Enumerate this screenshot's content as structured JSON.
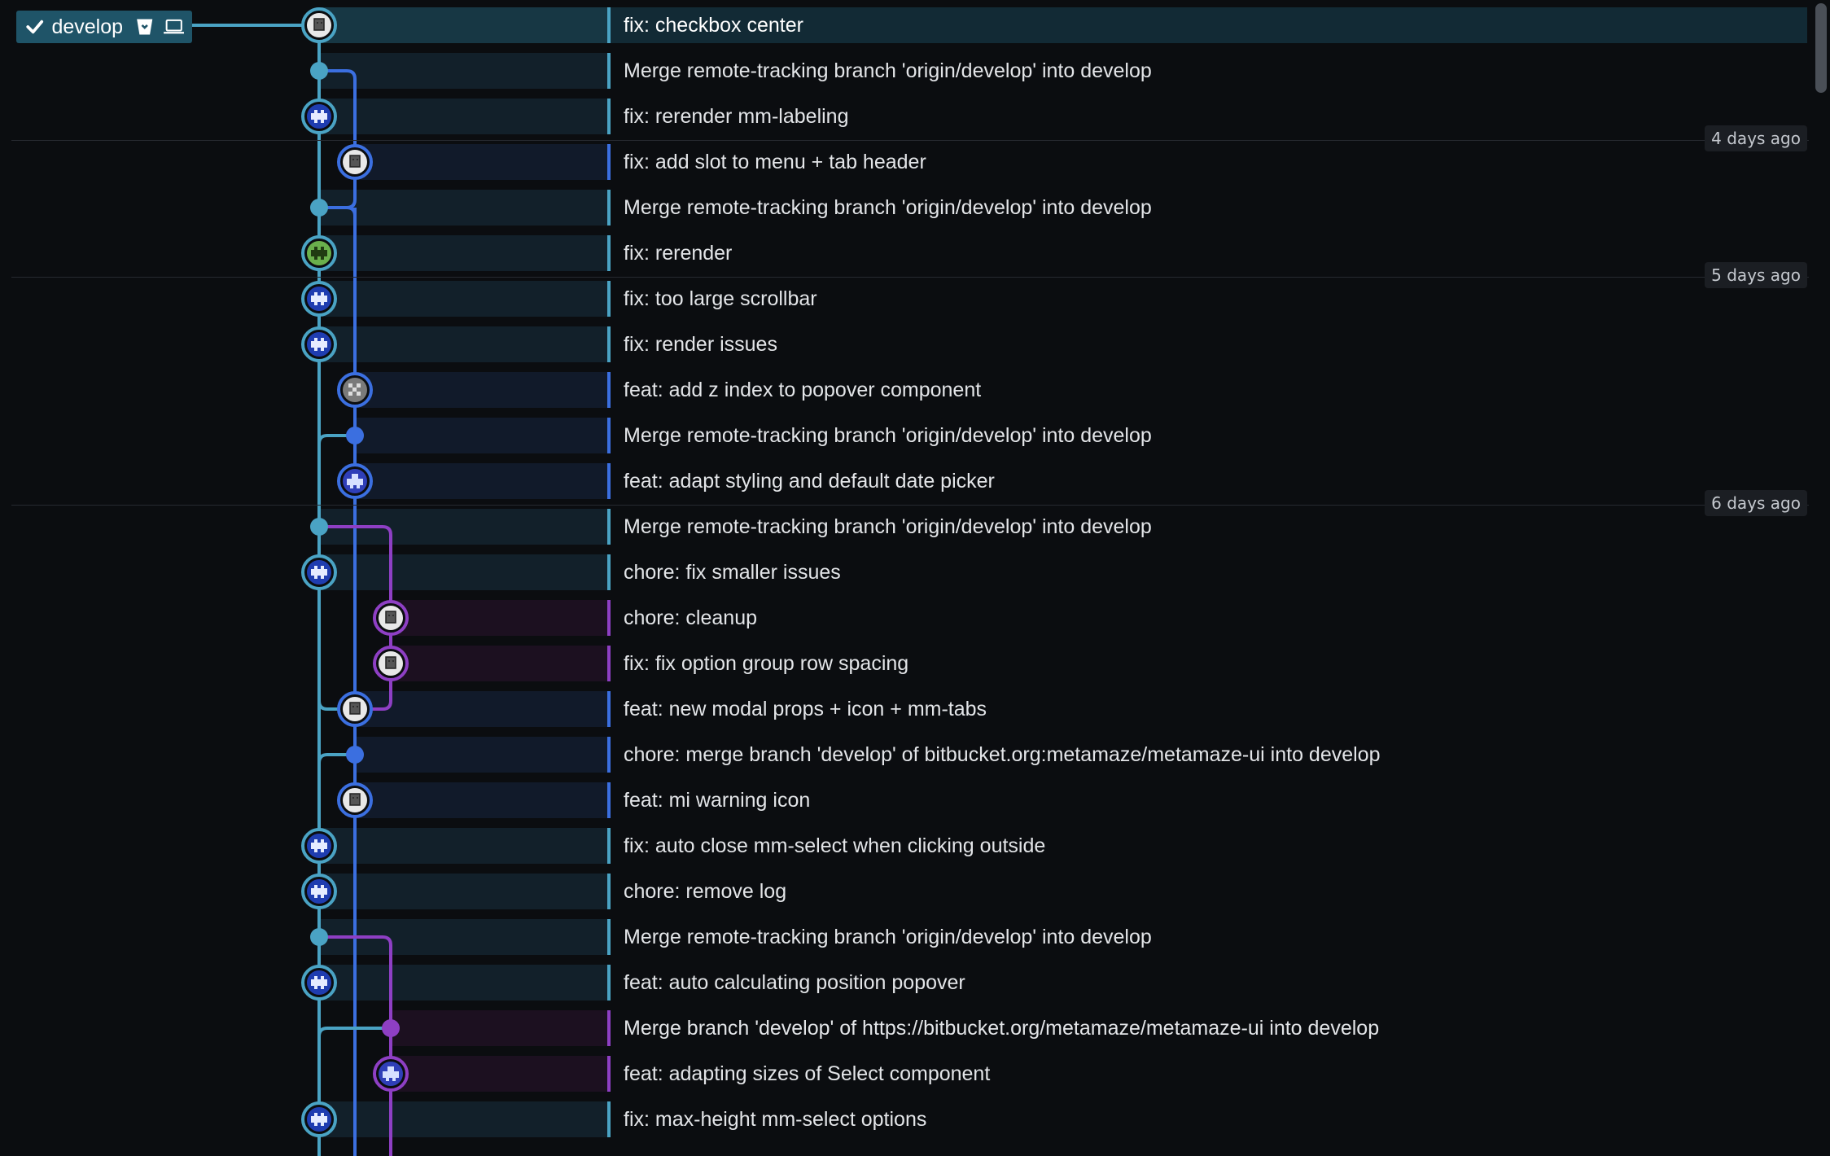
{
  "branch": {
    "name": "develop"
  },
  "date_labels": [
    "4 days ago",
    "5 days ago",
    "6 days ago"
  ],
  "colors": {
    "lane0": "#4aa3c4",
    "lane1": "#3b6fe0",
    "lane2": "#8e3fc4",
    "selected_row": "#173744"
  },
  "commits": [
    {
      "message": "fix: checkbox center",
      "lane": 0,
      "avatar": "avatar-face-icon"
    },
    {
      "message": "Merge remote-tracking branch 'origin/develop' into develop",
      "lane": 0,
      "avatar": "merge-dot"
    },
    {
      "message": "fix: rerender mm-labeling",
      "lane": 0,
      "avatar": "avatar-invader-icon"
    },
    {
      "message": "fix: add slot to menu + tab header",
      "lane": 1,
      "avatar": "avatar-face-icon"
    },
    {
      "message": "Merge remote-tracking branch 'origin/develop' into develop",
      "lane": 0,
      "avatar": "merge-dot"
    },
    {
      "message": "fix: rerender",
      "lane": 0,
      "avatar": "avatar-green-invader-icon"
    },
    {
      "message": "fix: too large scrollbar",
      "lane": 0,
      "avatar": "avatar-invader-icon"
    },
    {
      "message": "fix: render issues",
      "lane": 0,
      "avatar": "avatar-invader-icon"
    },
    {
      "message": "feat: add z index to popover component",
      "lane": 1,
      "avatar": "avatar-pixel-icon"
    },
    {
      "message": "Merge remote-tracking branch 'origin/develop' into develop",
      "lane": 1,
      "avatar": "merge-dot"
    },
    {
      "message": "feat: adapt styling and default date picker",
      "lane": 1,
      "avatar": "avatar-ship-icon"
    },
    {
      "message": "Merge remote-tracking branch 'origin/develop' into develop",
      "lane": 0,
      "avatar": "merge-dot"
    },
    {
      "message": "chore: fix smaller issues",
      "lane": 0,
      "avatar": "avatar-invader-icon"
    },
    {
      "message": "chore: cleanup",
      "lane": 2,
      "avatar": "avatar-face-icon"
    },
    {
      "message": "fix: fix option group row spacing",
      "lane": 2,
      "avatar": "avatar-face-icon"
    },
    {
      "message": "feat: new modal props + icon + mm-tabs",
      "lane": 1,
      "avatar": "avatar-face-icon"
    },
    {
      "message": "chore: merge branch 'develop' of bitbucket.org:metamaze/metamaze-ui into develop",
      "lane": 1,
      "avatar": "merge-dot"
    },
    {
      "message": "feat: mi warning icon",
      "lane": 1,
      "avatar": "avatar-face-icon"
    },
    {
      "message": "fix: auto close mm-select when clicking outside",
      "lane": 0,
      "avatar": "avatar-invader-icon"
    },
    {
      "message": "chore: remove log",
      "lane": 0,
      "avatar": "avatar-invader-icon"
    },
    {
      "message": "Merge remote-tracking branch 'origin/develop' into develop",
      "lane": 0,
      "avatar": "merge-dot"
    },
    {
      "message": "feat: auto calculating position popover",
      "lane": 0,
      "avatar": "avatar-invader-icon"
    },
    {
      "message": "Merge branch 'develop' of https://bitbucket.org/metamaze/metamaze-ui into develop",
      "lane": 2,
      "avatar": "merge-dot"
    },
    {
      "message": "feat: adapting sizes of Select component",
      "lane": 2,
      "avatar": "avatar-ship-icon"
    },
    {
      "message": "fix: max-height mm-select options",
      "lane": 0,
      "avatar": "avatar-invader-icon"
    }
  ]
}
